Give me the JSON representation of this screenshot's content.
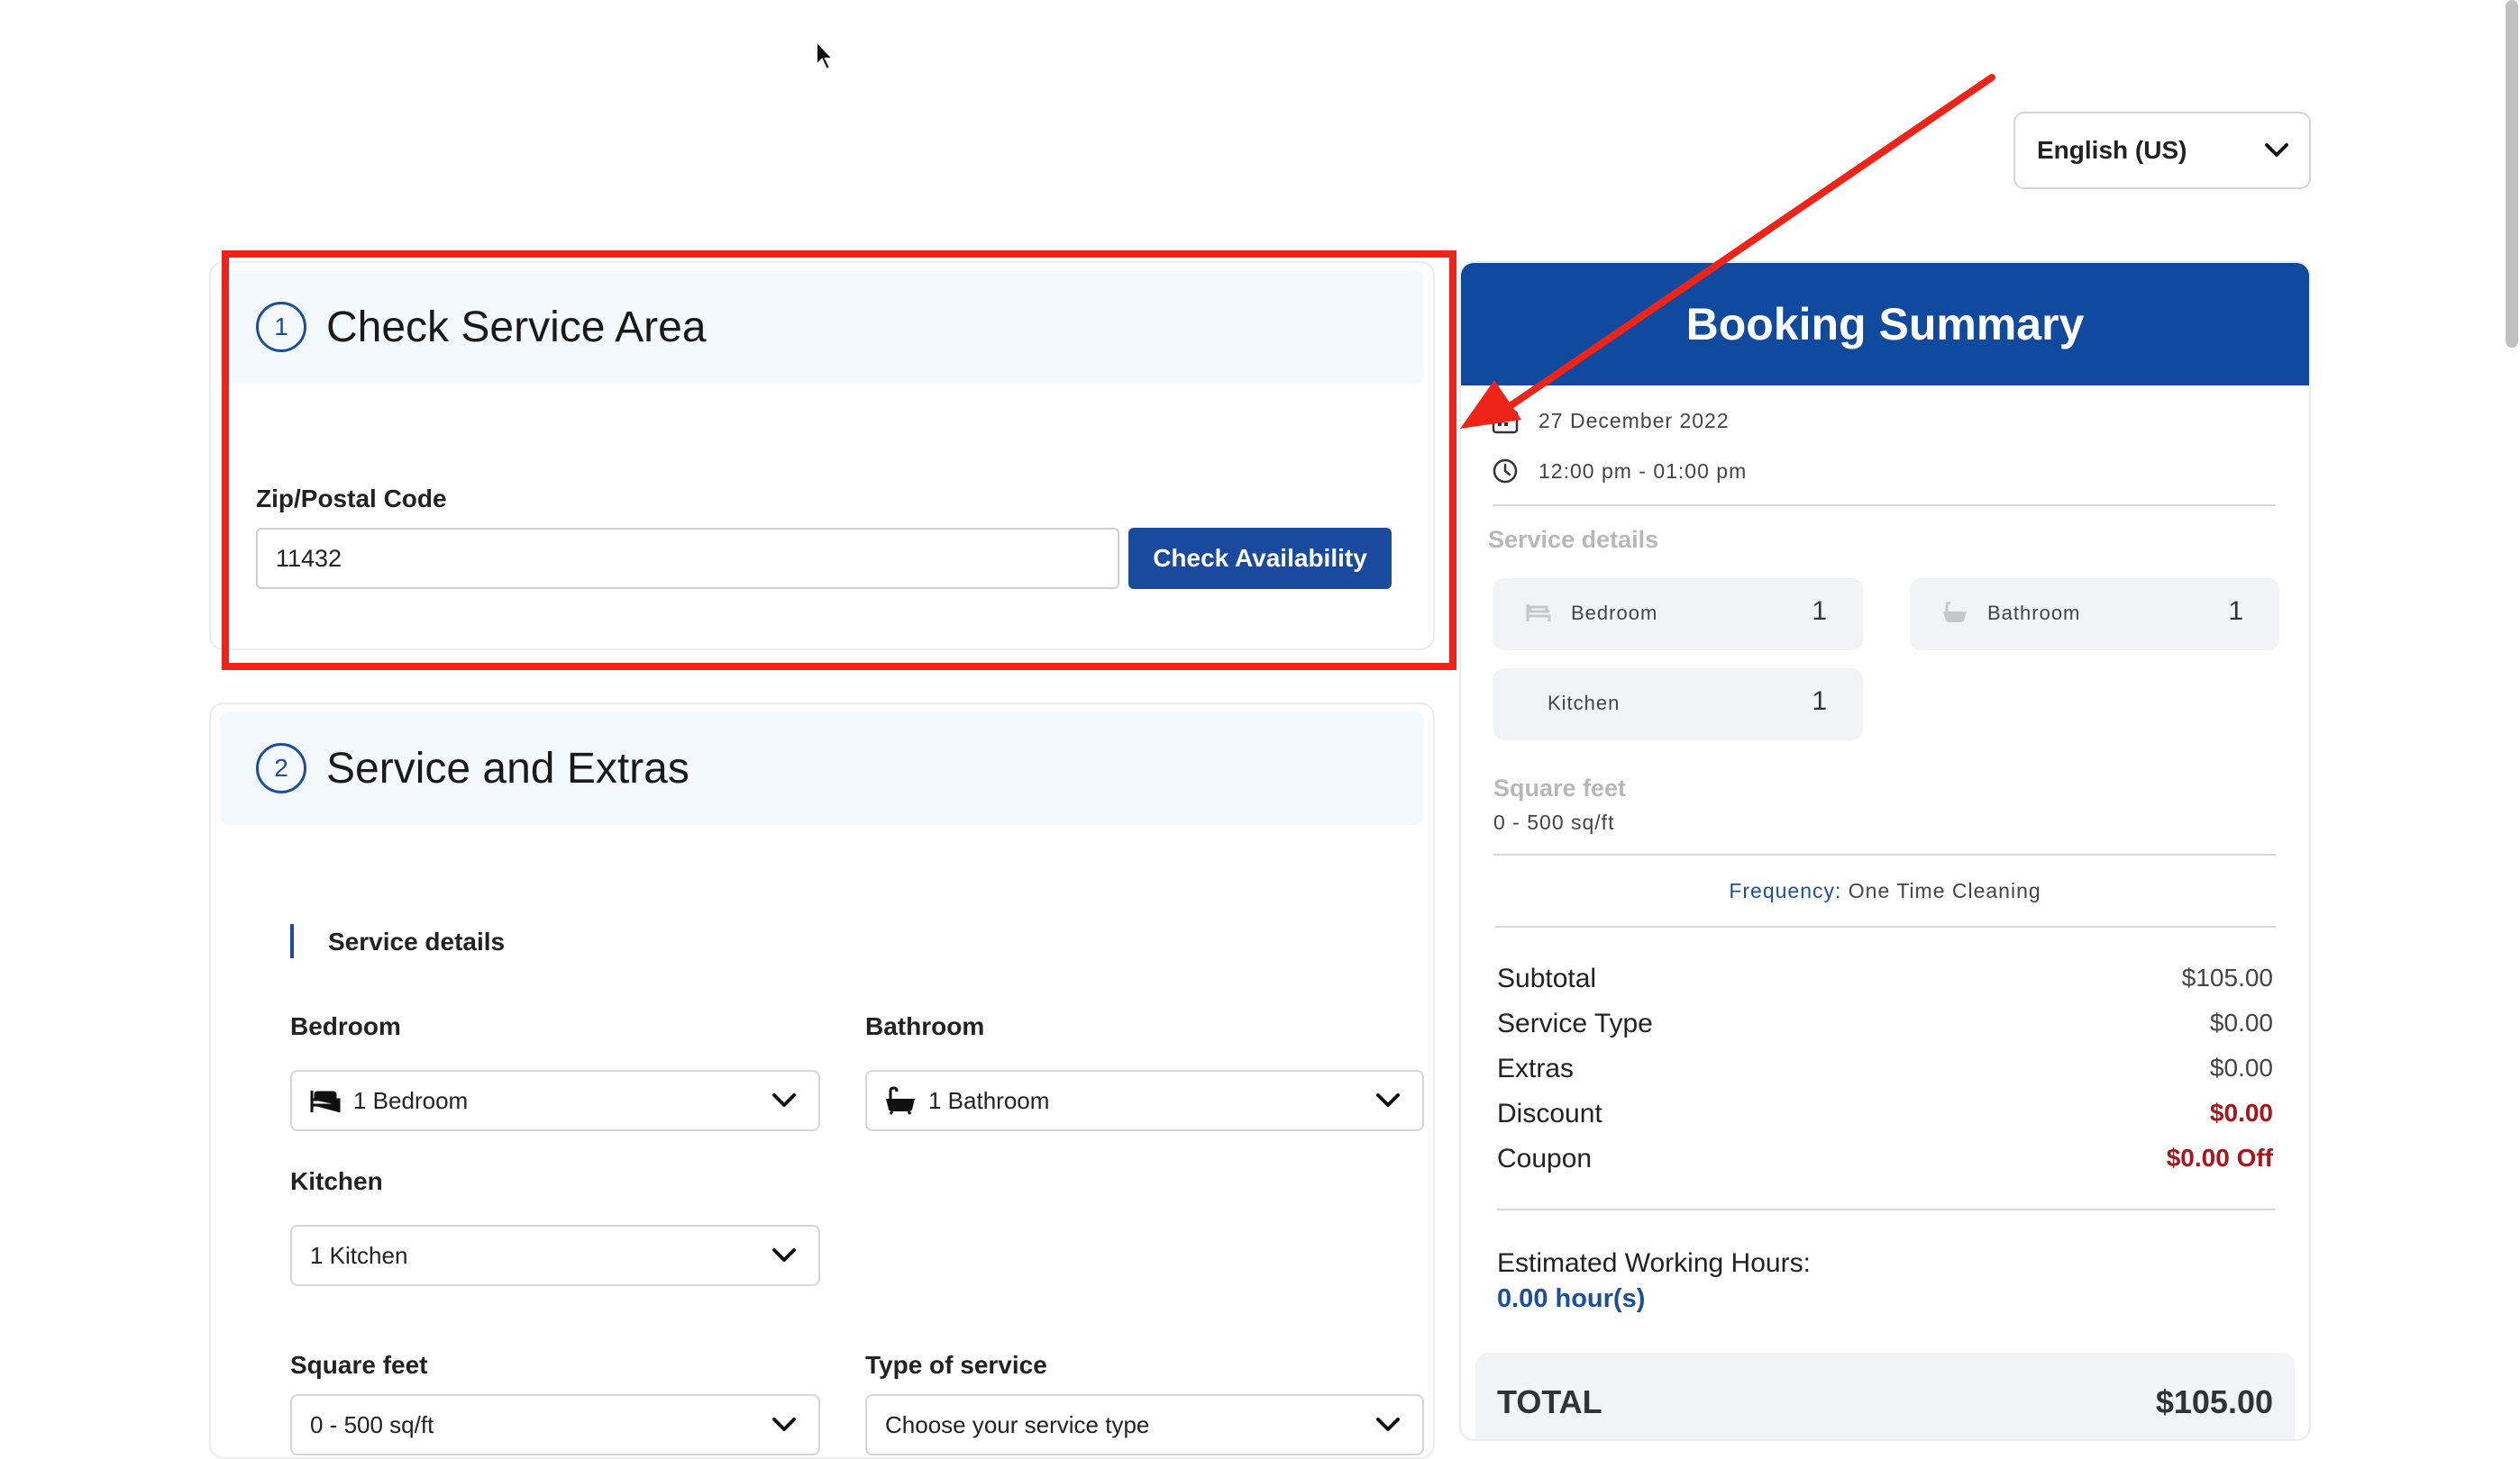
{
  "language": {
    "selected": "English (US)"
  },
  "step1": {
    "number": "1",
    "title": "Check Service Area",
    "zip_label": "Zip/Postal Code",
    "zip_value": "11432",
    "check_button": "Check Availability"
  },
  "step2": {
    "number": "2",
    "title": "Service and Extras",
    "section_title": "Service details",
    "bedroom_label": "Bedroom",
    "bedroom_value": "1 Bedroom",
    "bathroom_label": "Bathroom",
    "bathroom_value": "1 Bathroom",
    "kitchen_label": "Kitchen",
    "kitchen_value": "1 Kitchen",
    "sqft_label": "Square feet",
    "sqft_value": "0 - 500 sq/ft",
    "type_label": "Type of service",
    "type_value": "Choose your service type"
  },
  "summary": {
    "title": "Booking Summary",
    "date": "27 December 2022",
    "time": "12:00 pm - 01:00 pm",
    "service_details_label": "Service details",
    "tiles": [
      {
        "name": "Bedroom",
        "value": "1"
      },
      {
        "name": "Bathroom",
        "value": "1"
      },
      {
        "name": "Kitchen",
        "value": "1"
      }
    ],
    "sqft_label": "Square feet",
    "sqft_value": "0 - 500 sq/ft",
    "frequency_label": "Frequency:",
    "frequency_value": "One Time Cleaning",
    "rows": [
      {
        "label": "Subtotal",
        "value": "$105.00"
      },
      {
        "label": "Service Type",
        "value": "$0.00"
      },
      {
        "label": "Extras",
        "value": "$0.00"
      },
      {
        "label": "Discount",
        "value": "$0.00"
      },
      {
        "label": "Coupon",
        "value": "$0.00 Off"
      }
    ],
    "hours_label": "Estimated Working Hours:",
    "hours_value": "0.00 hour(s)",
    "total_label": "TOTAL",
    "total_value": "$105.00"
  },
  "colors": {
    "primary": "#0f4a9e",
    "annotation": "#ee2419",
    "negative": "#a8151b"
  },
  "icons": [
    "cursor-icon",
    "chevron-down-icon",
    "calendar-icon",
    "clock-icon",
    "bed-icon",
    "bathtub-icon"
  ]
}
